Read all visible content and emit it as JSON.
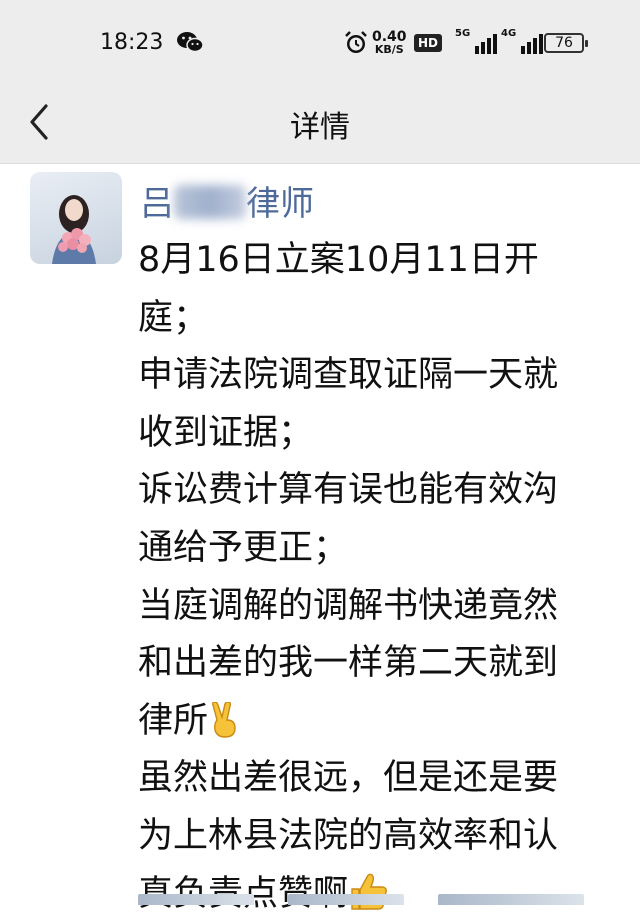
{
  "status_bar": {
    "time": "18:23",
    "net_speed_value": "0.40",
    "net_speed_unit": "KB/S",
    "hd_label": "HD",
    "sim1_label": "5G",
    "sim2_label": "4G",
    "battery": "76",
    "icons": [
      "wechat-icon",
      "alarm-icon",
      "signal-5g-icon",
      "signal-4g-icon",
      "battery-icon"
    ]
  },
  "nav": {
    "back_icon": "chevron-left-icon",
    "title": "详情"
  },
  "post": {
    "author_prefix": "吕",
    "author_suffix": "律师",
    "lines": [
      "8月16日立案10月11日开",
      "庭；",
      "申请法院调查取证隔一天就",
      "收到证据；",
      "诉讼费计算有误也能有效沟",
      "通给予更正；",
      "当庭调解的调解书快递竟然",
      "和出差的我一样第二天就到",
      "律所",
      "虽然出差很远，但是还是要",
      "为上林县法院的高效率和认",
      "真负责点赞啊"
    ],
    "emoji": [
      "victory-hand-icon",
      "thumbs-up-icon"
    ]
  }
}
